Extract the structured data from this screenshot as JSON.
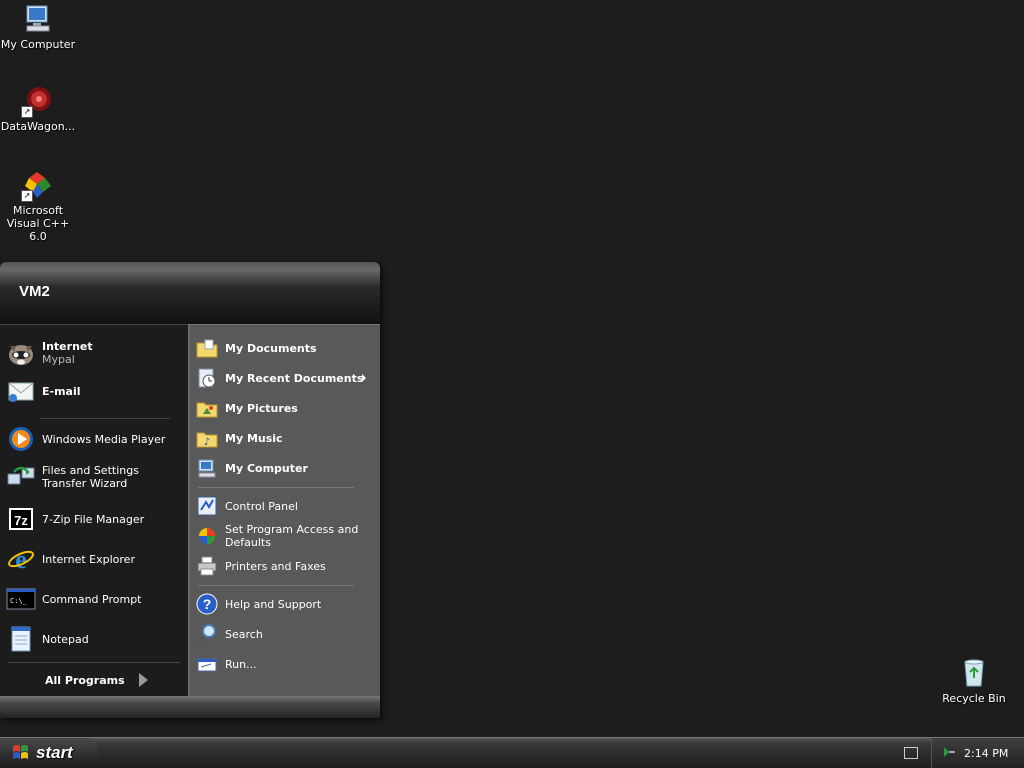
{
  "desktop": {
    "icons": [
      {
        "label": "My Computer"
      },
      {
        "label": "DataWagon..."
      },
      {
        "label": "Microsoft Visual C++ 6.0"
      },
      {
        "label": "Recycle Bin"
      }
    ]
  },
  "start_menu": {
    "user_name": "VM2",
    "pinned": [
      {
        "title": "Internet",
        "subtitle": "Mypal"
      },
      {
        "title": "E-mail",
        "subtitle": ""
      }
    ],
    "recent_programs": [
      {
        "label": "Windows Media Player"
      },
      {
        "label": "Files and Settings Transfer Wizard"
      },
      {
        "label": "7-Zip File Manager"
      },
      {
        "label": "Internet Explorer"
      },
      {
        "label": "Command Prompt"
      },
      {
        "label": "Notepad"
      }
    ],
    "all_programs_label": "All Programs",
    "right_column": {
      "places": [
        {
          "label": "My Documents"
        },
        {
          "label": "My Recent Documents"
        },
        {
          "label": "My Pictures"
        },
        {
          "label": "My Music"
        },
        {
          "label": "My Computer"
        }
      ],
      "settings": [
        {
          "label": "Control Panel"
        },
        {
          "label": "Set Program Access and Defaults"
        },
        {
          "label": "Printers and Faxes"
        }
      ],
      "tools": [
        {
          "label": "Help and Support"
        },
        {
          "label": "Search"
        },
        {
          "label": "Run..."
        }
      ]
    }
  },
  "taskbar": {
    "start_label": "start",
    "clock": "2:14 PM"
  },
  "colors": {
    "desktop_bg": "#1d1d1d",
    "menu_left_bg": "#1c1c1c",
    "menu_right_bg": "#595959"
  }
}
